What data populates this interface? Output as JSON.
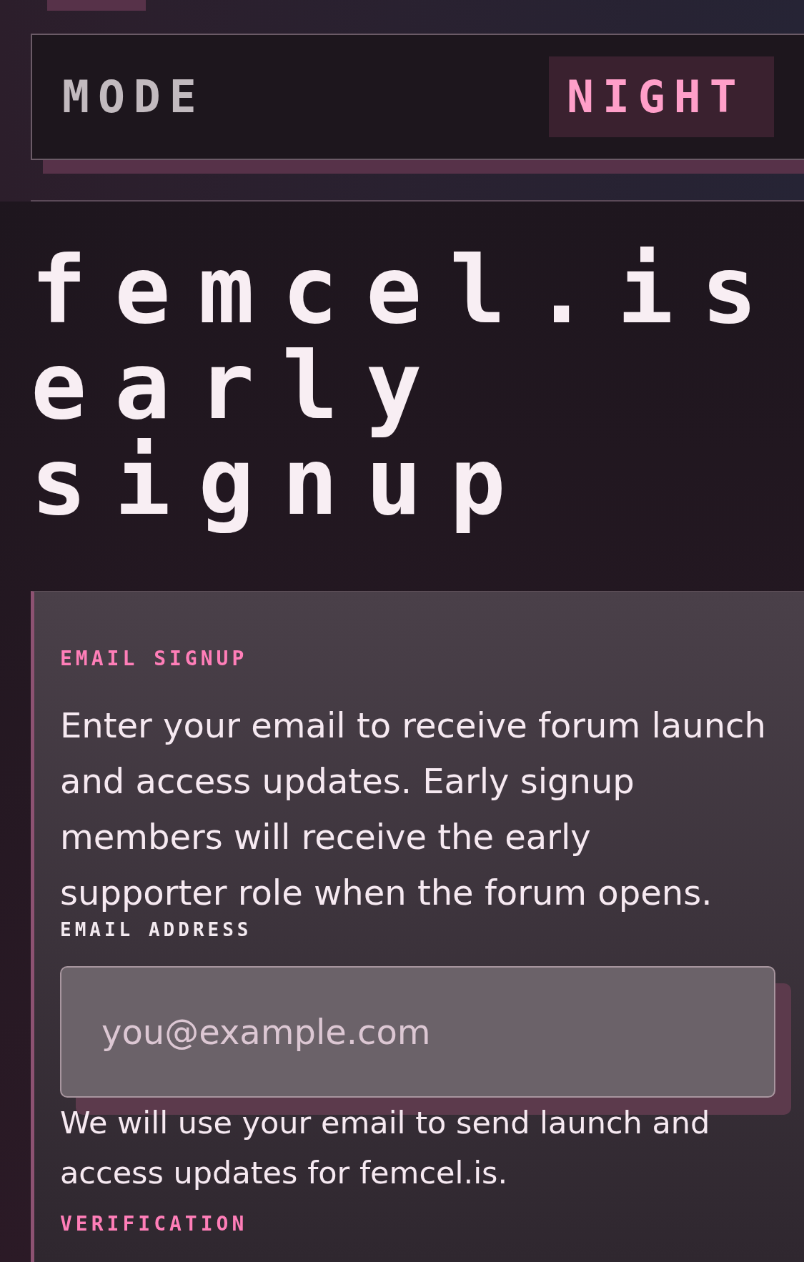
{
  "header": {
    "mode_toggle": {
      "label": "MODE",
      "value": "NIGHT"
    }
  },
  "title": "femcel.is early signup",
  "signup_card": {
    "eyebrow": "EMAIL SIGNUP",
    "description": "Enter your email to receive forum launch and access updates. Early signup members will receive the early supporter role when the forum opens.",
    "email_field": {
      "label": "EMAIL ADDRESS",
      "placeholder": "you@example.com",
      "help": "We will use your email to send launch and access updates for femcel.is."
    },
    "next_section": "VERIFICATION"
  }
}
